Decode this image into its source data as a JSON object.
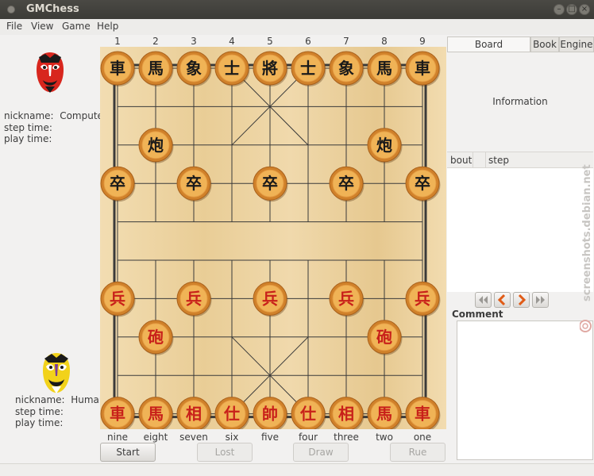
{
  "window": {
    "title": "GMChess"
  },
  "menu": [
    {
      "label": "File"
    },
    {
      "label": "View"
    },
    {
      "label": "Game"
    },
    {
      "label": "Help"
    }
  ],
  "players": {
    "top": {
      "nickname_label": "nickname:",
      "nickname": "Computer",
      "step_time_label": "step time:",
      "play_time_label": "play time:"
    },
    "bottom": {
      "nickname_label": "nickname:",
      "nickname": "Human",
      "step_time_label": "step time:",
      "play_time_label": "play time:"
    }
  },
  "columns": {
    "top": [
      "1",
      "2",
      "3",
      "4",
      "5",
      "6",
      "7",
      "8",
      "9"
    ],
    "bottom": [
      "nine",
      "eight",
      "seven",
      "six",
      "five",
      "four",
      "three",
      "two",
      "one"
    ]
  },
  "pieces": {
    "black": [
      {
        "char": "車",
        "file": 0,
        "rank": 0
      },
      {
        "char": "馬",
        "file": 1,
        "rank": 0
      },
      {
        "char": "象",
        "file": 2,
        "rank": 0
      },
      {
        "char": "士",
        "file": 3,
        "rank": 0
      },
      {
        "char": "將",
        "file": 4,
        "rank": 0
      },
      {
        "char": "士",
        "file": 5,
        "rank": 0
      },
      {
        "char": "象",
        "file": 6,
        "rank": 0
      },
      {
        "char": "馬",
        "file": 7,
        "rank": 0
      },
      {
        "char": "車",
        "file": 8,
        "rank": 0
      },
      {
        "char": "炮",
        "file": 1,
        "rank": 2
      },
      {
        "char": "炮",
        "file": 7,
        "rank": 2
      },
      {
        "char": "卒",
        "file": 0,
        "rank": 3
      },
      {
        "char": "卒",
        "file": 2,
        "rank": 3
      },
      {
        "char": "卒",
        "file": 4,
        "rank": 3
      },
      {
        "char": "卒",
        "file": 6,
        "rank": 3
      },
      {
        "char": "卒",
        "file": 8,
        "rank": 3
      }
    ],
    "red": [
      {
        "char": "兵",
        "file": 0,
        "rank": 6
      },
      {
        "char": "兵",
        "file": 2,
        "rank": 6
      },
      {
        "char": "兵",
        "file": 4,
        "rank": 6
      },
      {
        "char": "兵",
        "file": 6,
        "rank": 6
      },
      {
        "char": "兵",
        "file": 8,
        "rank": 6
      },
      {
        "char": "砲",
        "file": 1,
        "rank": 7
      },
      {
        "char": "砲",
        "file": 7,
        "rank": 7
      },
      {
        "char": "車",
        "file": 0,
        "rank": 9
      },
      {
        "char": "馬",
        "file": 1,
        "rank": 9
      },
      {
        "char": "相",
        "file": 2,
        "rank": 9
      },
      {
        "char": "仕",
        "file": 3,
        "rank": 9
      },
      {
        "char": "帥",
        "file": 4,
        "rank": 9
      },
      {
        "char": "仕",
        "file": 5,
        "rank": 9
      },
      {
        "char": "相",
        "file": 6,
        "rank": 9
      },
      {
        "char": "馬",
        "file": 7,
        "rank": 9
      },
      {
        "char": "車",
        "file": 8,
        "rank": 9
      }
    ]
  },
  "buttons": {
    "start": "Start",
    "lost": "Lost",
    "draw": "Draw",
    "rue": "Rue"
  },
  "tabs": [
    {
      "label": "Board Information",
      "active": true
    },
    {
      "label": "Book",
      "active": false
    },
    {
      "label": "Engine",
      "active": false
    }
  ],
  "info_panel": {
    "title": "Information"
  },
  "move_list": {
    "col_bout": "bout",
    "col_step": "step"
  },
  "comment": {
    "label": "Comment"
  },
  "watermark": {
    "text": "screenshots.debian.net"
  },
  "colors": {
    "black_piece_text": "#1a1a1a",
    "red_piece_text": "#c8201a",
    "piece_face": "#f0b356",
    "board_line": "#3a3a3a"
  }
}
